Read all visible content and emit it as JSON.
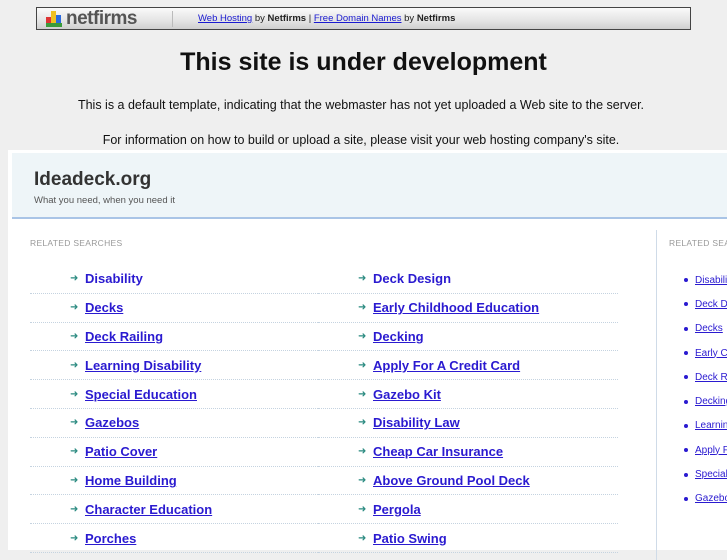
{
  "topbar": {
    "logo": "netfirms",
    "link1": "Web Hosting",
    "by1": "by",
    "brand1": "Netfirms",
    "divider": "|",
    "link2": "Free Domain Names",
    "by2": "by",
    "brand2": "Netfirms"
  },
  "heading": "This site is under development",
  "para1": "This is a default template, indicating that the webmaster has not yet uploaded a Web site to the server.",
  "para2": "For information on how to build or upload a site, please visit your web hosting company's site.",
  "site": {
    "name": "Ideadeck.org",
    "tagline": "What you need, when you need it"
  },
  "related_label": "RELATED SEARCHES",
  "left_links": [
    "Disability",
    "Decks",
    "Deck Railing",
    "Learning Disability",
    "Special Education",
    "Gazebos",
    "Patio Cover",
    "Home Building",
    "Character Education",
    "Porches"
  ],
  "middle_links": [
    "Deck Design",
    "Early Childhood Education",
    "Decking",
    "Apply For A Credit Card",
    "Gazebo Kit",
    "Disability Law",
    "Cheap Car Insurance",
    "Above Ground Pool Deck",
    "Pergola",
    "Patio Swing"
  ],
  "right_label": "RELATED SEARCHES",
  "right_links": [
    "Disability",
    "Deck Design",
    "Decks",
    "Early Childhood Education",
    "Deck Railing",
    "Decking",
    "Learning Disability",
    "Apply For A Credit Card",
    "Special Education",
    "Gazebo Kit"
  ]
}
